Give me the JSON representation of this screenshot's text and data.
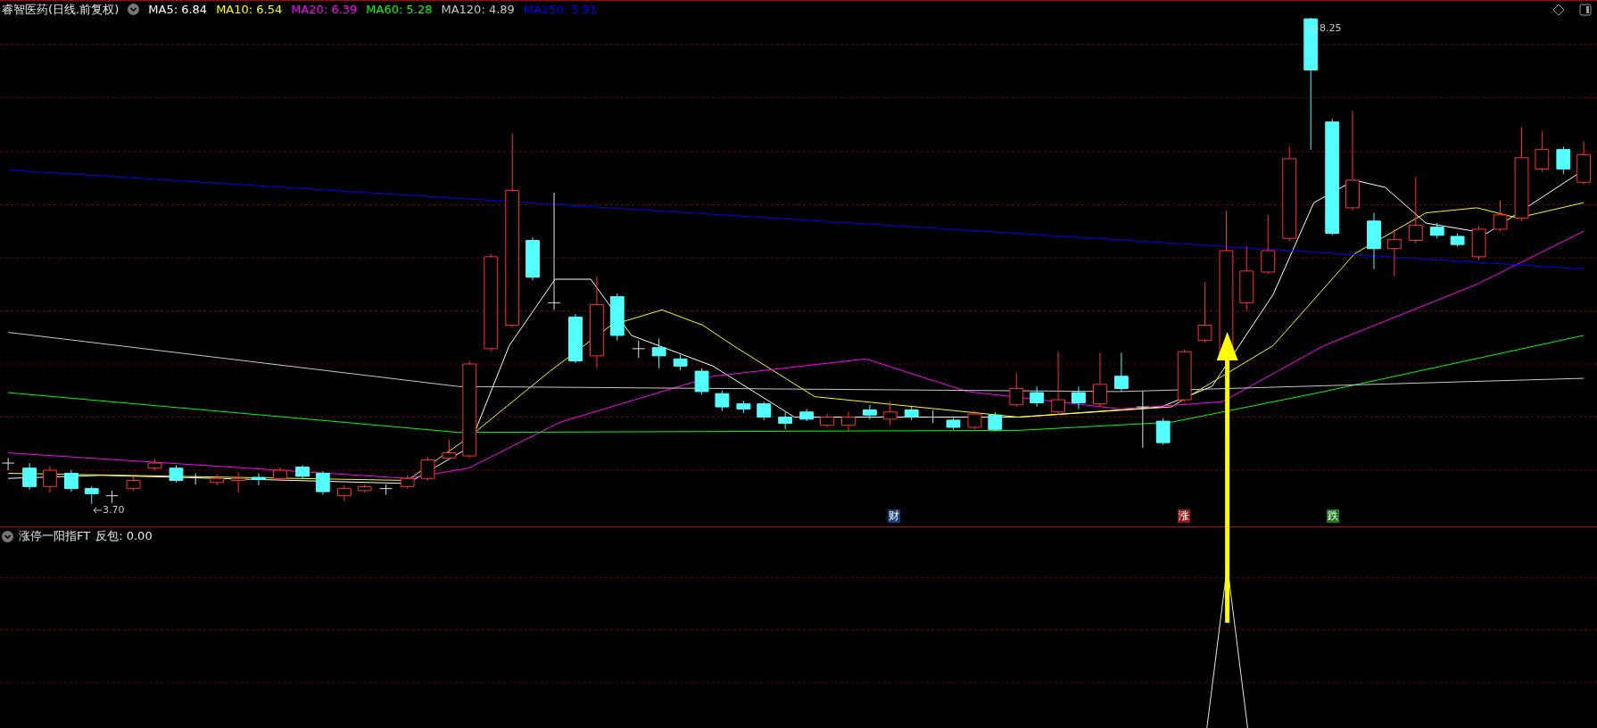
{
  "header": {
    "title": "睿智医药(日线.前复权)"
  },
  "ma_legend": [
    {
      "label": "MA5: 6.84",
      "color": "#ffffff"
    },
    {
      "label": "MA10: 6.54",
      "color": "#ffff00"
    },
    {
      "label": "MA20: 6.39",
      "color": "#ff00ff"
    },
    {
      "label": "MA60: 5.28",
      "color": "#00ff00"
    },
    {
      "label": "MA120: 4.89",
      "color": "#c8c8c8"
    },
    {
      "label": "MA250: 5.91",
      "color": "#0000ff"
    }
  ],
  "price_labels": [
    {
      "kind": "high",
      "text": "8.25"
    },
    {
      "kind": "low",
      "text": "3.70"
    }
  ],
  "signal_markers": [
    {
      "text": "财",
      "color": "#1a3e7a"
    },
    {
      "text": "涨",
      "color": "#8b1a1a"
    },
    {
      "text": "跌",
      "color": "#1e7a1e"
    }
  ],
  "indicator_panel": {
    "title": "涨停一阳指FT",
    "reading": "反包: 0.00"
  }
}
